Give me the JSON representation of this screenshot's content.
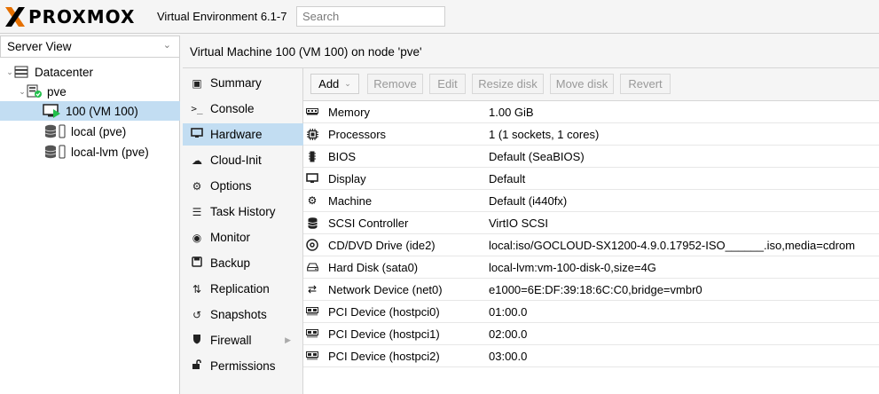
{
  "header": {
    "logo_text": "PROXMOX",
    "version": "Virtual Environment 6.1-7",
    "search_placeholder": "Search"
  },
  "sidebar": {
    "view_select": "Server View",
    "tree": [
      {
        "label": "Datacenter",
        "icon": "datacenter-icon"
      },
      {
        "label": "pve",
        "icon": "node-online-icon"
      },
      {
        "label": "100 (VM 100)",
        "icon": "vm-running-icon",
        "selected": true
      },
      {
        "label": "local (pve)",
        "icon": "storage-icon"
      },
      {
        "label": "local-lvm (pve)",
        "icon": "storage-icon"
      }
    ]
  },
  "main": {
    "title": "Virtual Machine 100 (VM 100) on node 'pve'",
    "nav": [
      {
        "label": "Summary",
        "icon": "summary-icon"
      },
      {
        "label": "Console",
        "icon": "console-icon"
      },
      {
        "label": "Hardware",
        "icon": "desktop-icon",
        "selected": true
      },
      {
        "label": "Cloud-Init",
        "icon": "cloud-icon"
      },
      {
        "label": "Options",
        "icon": "gear-icon"
      },
      {
        "label": "Task History",
        "icon": "list-icon"
      },
      {
        "label": "Monitor",
        "icon": "eye-icon"
      },
      {
        "label": "Backup",
        "icon": "floppy-icon"
      },
      {
        "label": "Replication",
        "icon": "retweet-icon"
      },
      {
        "label": "Snapshots",
        "icon": "history-icon"
      },
      {
        "label": "Firewall",
        "icon": "shield-icon"
      },
      {
        "label": "Permissions",
        "icon": "unlock-icon"
      }
    ],
    "toolbar": {
      "add": "Add",
      "remove": "Remove",
      "edit": "Edit",
      "resize": "Resize disk",
      "move": "Move disk",
      "revert": "Revert"
    },
    "hardware": [
      {
        "name": "Memory",
        "value": "1.00 GiB",
        "icon": "memory-icon"
      },
      {
        "name": "Processors",
        "value": "1 (1 sockets, 1 cores)",
        "icon": "cpu-icon"
      },
      {
        "name": "BIOS",
        "value": "Default (SeaBIOS)",
        "icon": "microchip-icon"
      },
      {
        "name": "Display",
        "value": "Default",
        "icon": "desktop-icon"
      },
      {
        "name": "Machine",
        "value": "Default (i440fx)",
        "icon": "cogs-icon"
      },
      {
        "name": "SCSI Controller",
        "value": "VirtIO SCSI",
        "icon": "database-icon"
      },
      {
        "name": "CD/DVD Drive (ide2)",
        "value": "local:iso/GOCLOUD-SX1200-4.9.0.17952-ISO______.iso,media=cdrom",
        "icon": "cdrom-icon"
      },
      {
        "name": "Hard Disk (sata0)",
        "value": "local-lvm:vm-100-disk-0,size=4G",
        "icon": "hdd-icon"
      },
      {
        "name": "Network Device (net0)",
        "value": "e1000=6E:DF:39:18:6C:C0,bridge=vmbr0",
        "icon": "exchange-icon"
      },
      {
        "name": "PCI Device (hostpci0)",
        "value": "01:00.0",
        "icon": "pci-icon"
      },
      {
        "name": "PCI Device (hostpci1)",
        "value": "02:00.0",
        "icon": "pci-icon"
      },
      {
        "name": "PCI Device (hostpci2)",
        "value": "03:00.0",
        "icon": "pci-icon"
      }
    ]
  },
  "colors": {
    "selection": "#c2ddf2",
    "logo_orange": "#e57000",
    "status_green": "#21bf4b"
  }
}
